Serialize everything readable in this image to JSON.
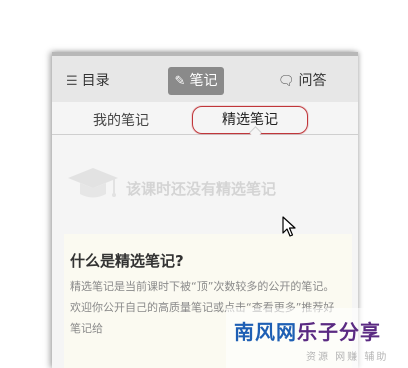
{
  "nav": {
    "toc_label": "目录",
    "notes_label": "笔记",
    "qa_label": "问答",
    "toc_icon": "list-icon",
    "notes_icon": "edit-icon",
    "qa_icon": "chat-icon"
  },
  "subtabs": {
    "mine_label": "我的笔记",
    "featured_label": "精选笔记",
    "highlight_color": "#c0363a"
  },
  "empty_state": {
    "icon": "graduation-cap-icon",
    "message": "该课时还没有精选笔记"
  },
  "info": {
    "title": "什么是精选笔记?",
    "text": "精选笔记是当前课时下被“顶”次数较多的公开的笔记。欢迎你公开自己的高质量笔记或点击“查看更多”推荐好笔记给"
  },
  "watermark": {
    "brand_part1": "南风网",
    "brand_part2": "乐子分享",
    "tagline": "资源 网赚 辅助"
  }
}
